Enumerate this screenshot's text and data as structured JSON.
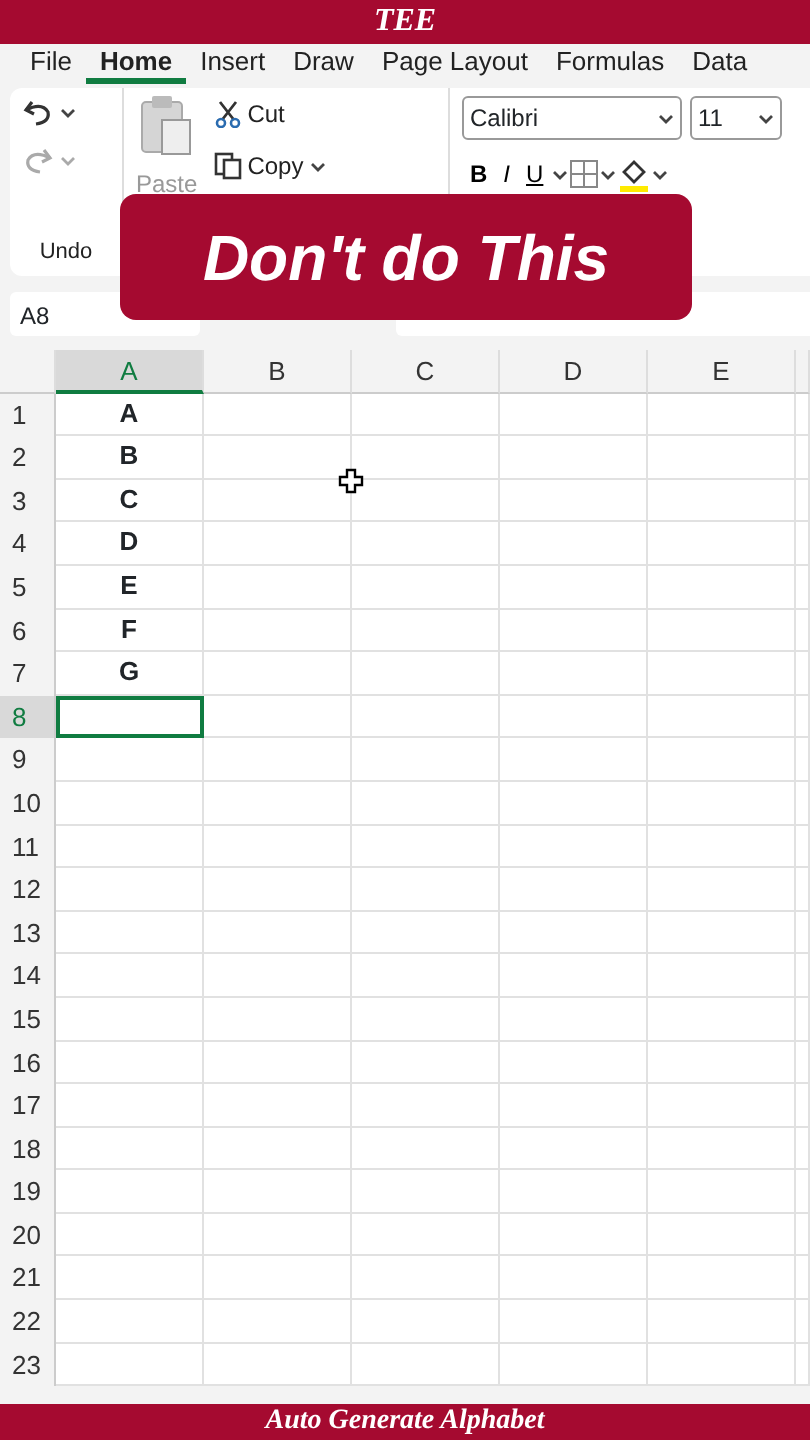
{
  "banner_top": {
    "title": "TEE"
  },
  "ribbon_tabs": [
    {
      "label": "File",
      "selected": false
    },
    {
      "label": "Home",
      "selected": true
    },
    {
      "label": "Insert",
      "selected": false
    },
    {
      "label": "Draw",
      "selected": false
    },
    {
      "label": "Page Layout",
      "selected": false
    },
    {
      "label": "Formulas",
      "selected": false
    },
    {
      "label": "Data",
      "selected": false
    }
  ],
  "ribbon": {
    "undo_label": "Undo",
    "paste_label": "Paste",
    "paste_disabled": true,
    "cut_label": "Cut",
    "copy_label": "Copy",
    "font_name": "Calibri",
    "font_size": "11",
    "format_buttons": [
      "B",
      "I",
      "U"
    ]
  },
  "overlay": {
    "text": "Don't do This"
  },
  "name_box": {
    "value": "A8"
  },
  "sheet": {
    "columns": [
      {
        "label": "A",
        "selected": true
      },
      {
        "label": "B",
        "selected": false
      },
      {
        "label": "C",
        "selected": false
      },
      {
        "label": "D",
        "selected": false
      },
      {
        "label": "E",
        "selected": false
      }
    ],
    "rows": [
      {
        "label": "1",
        "value": "A",
        "selected": false
      },
      {
        "label": "2",
        "value": "B",
        "selected": false
      },
      {
        "label": "3",
        "value": "C",
        "selected": false
      },
      {
        "label": "4",
        "value": "D",
        "selected": false
      },
      {
        "label": "5",
        "value": "E",
        "selected": false
      },
      {
        "label": "6",
        "value": "F",
        "selected": false
      },
      {
        "label": "7",
        "value": "G",
        "selected": false
      },
      {
        "label": "8",
        "selected": true
      },
      {
        "label": "9",
        "selected": false
      },
      {
        "label": "10",
        "selected": false
      },
      {
        "label": "11",
        "selected": false
      },
      {
        "label": "12",
        "selected": false
      },
      {
        "label": "13",
        "selected": false
      },
      {
        "label": "14",
        "selected": false
      },
      {
        "label": "15",
        "selected": false
      },
      {
        "label": "16",
        "selected": false
      },
      {
        "label": "17",
        "selected": false
      },
      {
        "label": "18",
        "selected": false
      },
      {
        "label": "19",
        "selected": false
      },
      {
        "label": "20",
        "selected": false
      },
      {
        "label": "21",
        "selected": false
      },
      {
        "label": "22",
        "selected": false
      },
      {
        "label": "23",
        "selected": false
      }
    ]
  },
  "banner_bottom": {
    "title": "Auto Generate Alphabet"
  }
}
